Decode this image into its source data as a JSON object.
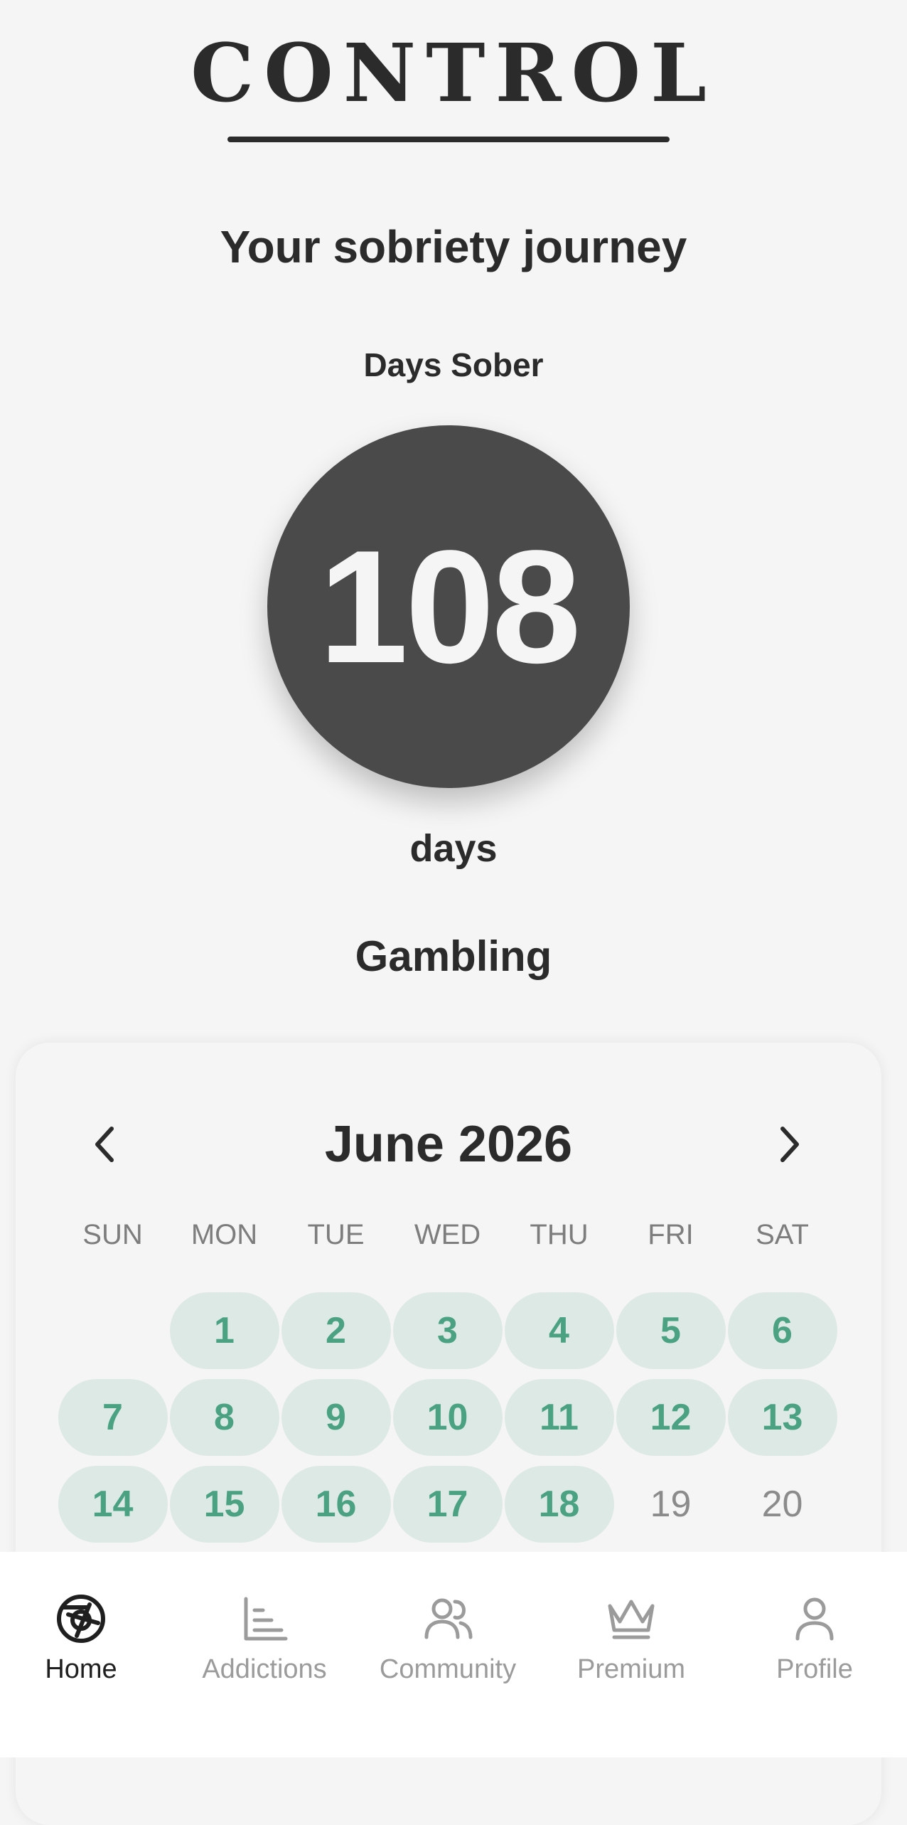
{
  "app": {
    "logo": "CONTROL"
  },
  "journey": {
    "heading": "Your sobriety journey",
    "counter_label": "Days Sober",
    "count": "108",
    "unit": "days",
    "addiction": "Gambling"
  },
  "calendar": {
    "month_title": "June 2026",
    "weekdays": [
      "SUN",
      "MON",
      "TUE",
      "WED",
      "THU",
      "FRI",
      "SAT"
    ],
    "leading_blanks": 1,
    "days": [
      {
        "label": "1",
        "sober": true
      },
      {
        "label": "2",
        "sober": true
      },
      {
        "label": "3",
        "sober": true
      },
      {
        "label": "4",
        "sober": true
      },
      {
        "label": "5",
        "sober": true
      },
      {
        "label": "6",
        "sober": true
      },
      {
        "label": "7",
        "sober": true
      },
      {
        "label": "8",
        "sober": true
      },
      {
        "label": "9",
        "sober": true
      },
      {
        "label": "10",
        "sober": true
      },
      {
        "label": "11",
        "sober": true
      },
      {
        "label": "12",
        "sober": true
      },
      {
        "label": "13",
        "sober": true
      },
      {
        "label": "14",
        "sober": true
      },
      {
        "label": "15",
        "sober": true
      },
      {
        "label": "16",
        "sober": true
      },
      {
        "label": "17",
        "sober": true
      },
      {
        "label": "18",
        "sober": true
      },
      {
        "label": "19",
        "sober": false
      },
      {
        "label": "20",
        "sober": false
      }
    ],
    "colors": {
      "sober_bg": "#dde9e4",
      "sober_text": "#4aa283",
      "plain_text": "#8b8b8b"
    }
  },
  "tabs": [
    {
      "label": "Home",
      "icon": "home-aperture-icon",
      "active": true
    },
    {
      "label": "Addictions",
      "icon": "bar-chart-icon",
      "active": false
    },
    {
      "label": "Community",
      "icon": "users-icon",
      "active": false
    },
    {
      "label": "Premium",
      "icon": "crown-icon",
      "active": false
    },
    {
      "label": "Profile",
      "icon": "user-icon",
      "active": false
    }
  ]
}
